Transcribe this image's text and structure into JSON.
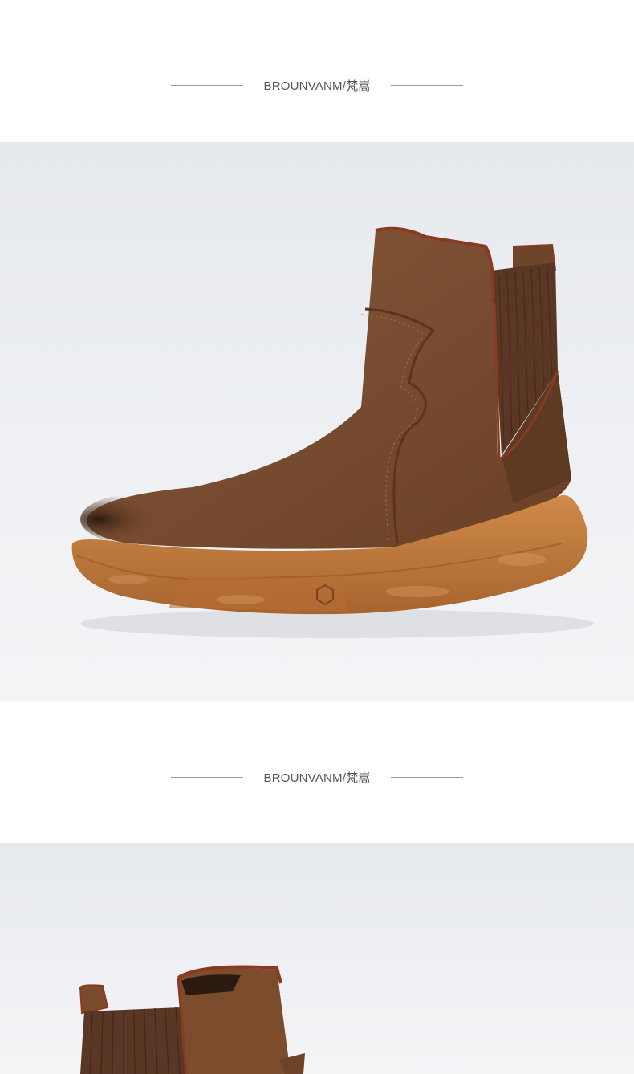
{
  "sections": [
    {
      "brand_label": "BROUNVANM/梵嵩"
    },
    {
      "brand_label": "BROUNVANM/梵嵩"
    }
  ],
  "colors": {
    "leather": "#7a4c2c",
    "leather_dark": "#4a2c18",
    "sole": "#c07a3e",
    "piping": "#8a3a22",
    "elastic": "#5a3624",
    "background": "#eceef1"
  }
}
